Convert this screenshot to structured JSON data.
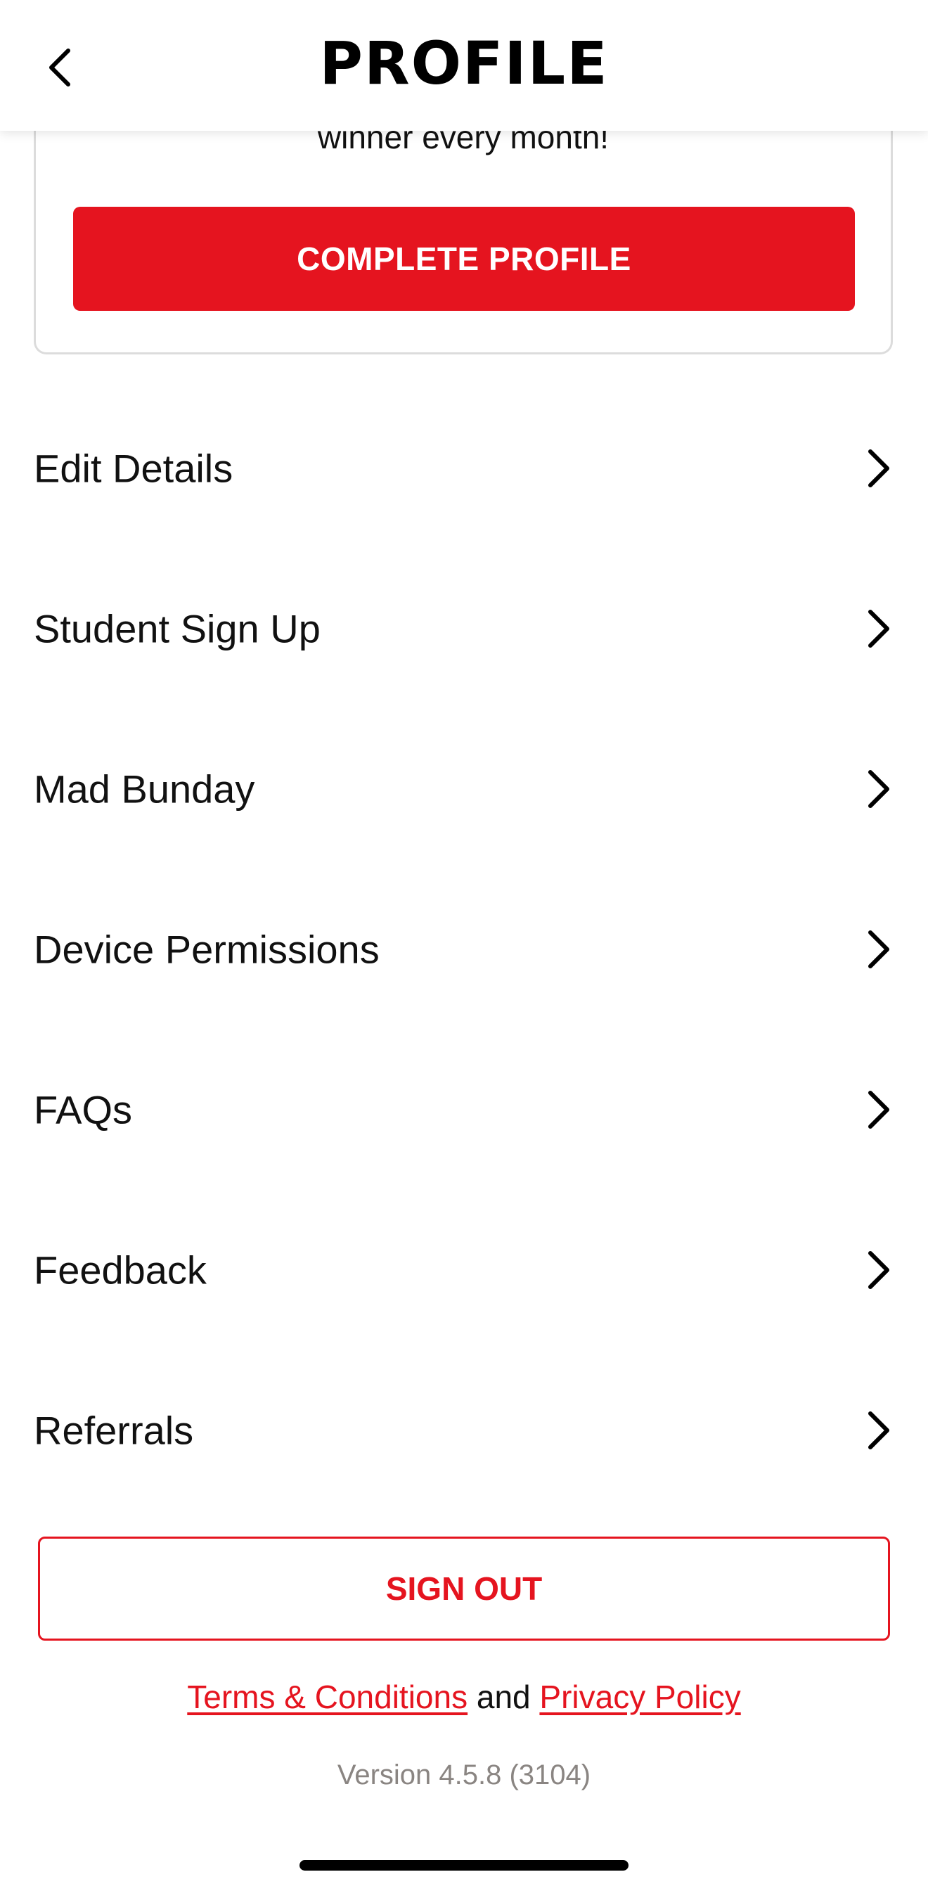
{
  "header": {
    "title": "PROFILE",
    "back_icon": "chevron-left-icon"
  },
  "promo": {
    "text": "winner every month!",
    "button_label": "COMPLETE PROFILE"
  },
  "menu": {
    "items": [
      {
        "label": "Edit Details"
      },
      {
        "label": "Student Sign Up"
      },
      {
        "label": "Mad Bunday"
      },
      {
        "label": "Device Permissions"
      },
      {
        "label": "FAQs"
      },
      {
        "label": "Feedback"
      },
      {
        "label": "Referrals"
      }
    ],
    "chevron_icon": "chevron-right-icon"
  },
  "sign_out": {
    "label": "SIGN OUT"
  },
  "legal": {
    "terms_label": "Terms & Conditions",
    "joiner": "and",
    "privacy_label": "Privacy Policy"
  },
  "footer": {
    "version": "Version 4.5.8 (3104)"
  },
  "colors": {
    "accent_red": "#e5141f",
    "text_primary": "#111111",
    "text_muted": "#8a8582",
    "card_border": "#dcdcdc"
  }
}
